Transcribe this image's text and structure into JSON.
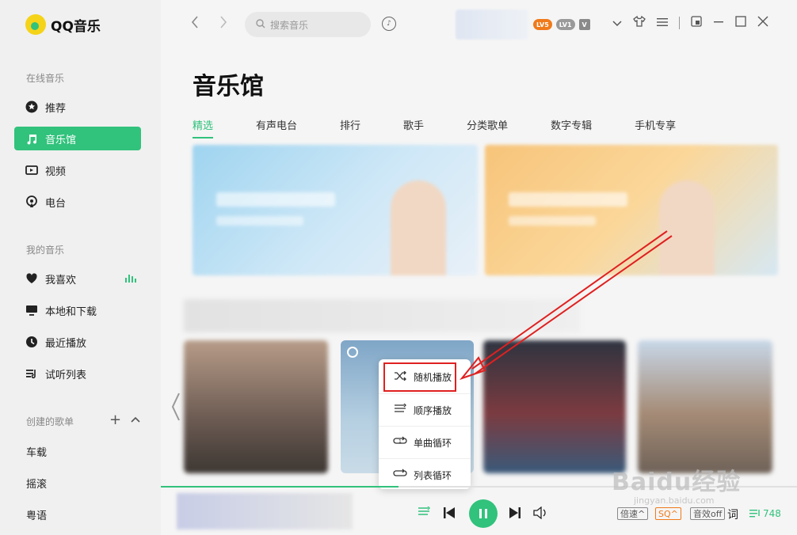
{
  "app": {
    "name": "QQ音乐"
  },
  "sidebar": {
    "online_title": "在线音乐",
    "online_items": [
      {
        "label": "推荐",
        "icon": "star-icon"
      },
      {
        "label": "音乐馆",
        "icon": "music-note-icon",
        "active": true
      },
      {
        "label": "视频",
        "icon": "video-icon"
      },
      {
        "label": "电台",
        "icon": "radio-icon"
      }
    ],
    "my_title": "我的音乐",
    "my_items": [
      {
        "label": "我喜欢",
        "icon": "heart-icon"
      },
      {
        "label": "本地和下载",
        "icon": "monitor-icon"
      },
      {
        "label": "最近播放",
        "icon": "clock-icon"
      },
      {
        "label": "试听列表",
        "icon": "playlist-icon"
      }
    ],
    "created_title": "创建的歌单",
    "created_items": [
      "车载",
      "摇滚",
      "粤语"
    ]
  },
  "topbar": {
    "search_placeholder": "搜索音乐",
    "badges": [
      "LV5",
      "LV1",
      "V"
    ]
  },
  "main": {
    "title": "音乐馆",
    "tabs": [
      "精选",
      "有声电台",
      "排行",
      "歌手",
      "分类歌单",
      "数字专辑",
      "手机专享"
    ]
  },
  "play_mode_menu": {
    "items": [
      {
        "label": "随机播放",
        "icon": "shuffle-icon",
        "selected": true
      },
      {
        "label": "顺序播放",
        "icon": "sequential-icon"
      },
      {
        "label": "单曲循环",
        "icon": "repeat-one-icon"
      },
      {
        "label": "列表循环",
        "icon": "repeat-list-icon"
      }
    ]
  },
  "player": {
    "speed_label": "倍速",
    "quality_label": "SQ",
    "effect_label": "音效off",
    "lyrics_label": "词",
    "playlist_count": "748"
  },
  "watermark": {
    "main": "Baidu经验",
    "sub": "jingyan.baidu.com"
  },
  "colors": {
    "accent": "#31c27c",
    "highlight": "#e02020"
  }
}
